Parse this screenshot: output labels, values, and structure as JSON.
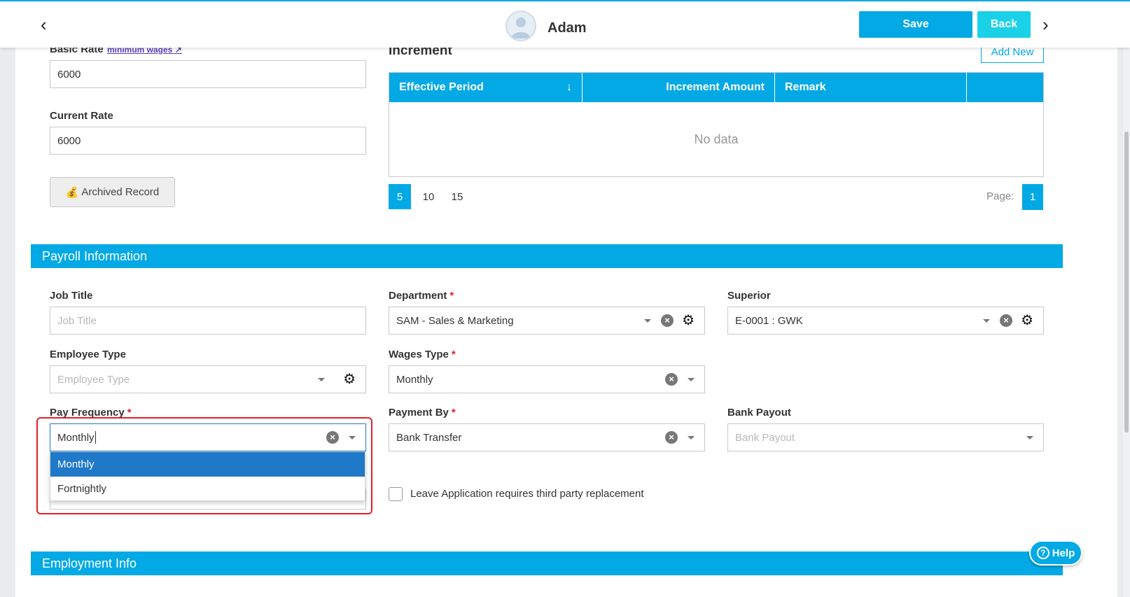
{
  "header": {
    "title": "Adam",
    "save_label": "Save",
    "back_label": "Back",
    "prev_glyph": "‹",
    "next_glyph": "›"
  },
  "rates": {
    "basic_rate_label": "Basic Rate",
    "minimum_wages_link": "minimum wages",
    "basic_rate_value": "6000",
    "current_rate_label": "Current Rate",
    "current_rate_value": "6000",
    "archived_record_label": "Archived Record"
  },
  "increment": {
    "title": "Increment",
    "add_new_label": "Add New",
    "columns": [
      "Effective Period",
      "Increment Amount",
      "Remark",
      ""
    ],
    "sort_glyph": "↓",
    "empty_text": "No data",
    "page_sizes": [
      "5",
      "10",
      "15"
    ],
    "page_label": "Page:",
    "current_page": "1"
  },
  "payroll": {
    "section_title": "Payroll Information",
    "job_title": {
      "label": "Job Title",
      "placeholder": "Job Title"
    },
    "department": {
      "label": "Department",
      "value": "SAM - Sales & Marketing"
    },
    "superior": {
      "label": "Superior",
      "value": "E-0001 : GWK"
    },
    "employee_type": {
      "label": "Employee Type",
      "placeholder": "Employee Type"
    },
    "wages_type": {
      "label": "Wages Type",
      "value": "Monthly"
    },
    "pay_frequency": {
      "label": "Pay Frequency",
      "value": "Monthly",
      "options": [
        "Monthly",
        "Fortnightly"
      ]
    },
    "payment_by": {
      "label": "Payment By",
      "value": "Bank Transfer"
    },
    "bank_payout": {
      "label": "Bank Payout",
      "placeholder": "Bank Payout"
    },
    "leave_checkbox_label": "Leave Application requires third party replacement"
  },
  "employment": {
    "section_title": "Employment Info"
  },
  "help": {
    "label": "Help"
  },
  "colors": {
    "accent": "#03a9e4",
    "back_button": "#1ad1e8",
    "dropdown_selected": "#1f78c8",
    "highlight_box": "#e0202a",
    "required": "#e0202a"
  }
}
